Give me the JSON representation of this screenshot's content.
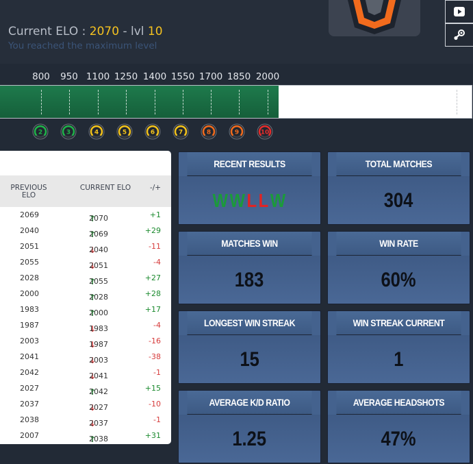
{
  "header": {
    "elo_label": "Current ELO : ",
    "elo_value": "2070",
    "separator": " - lvl ",
    "level": "10",
    "subtitle": "You reached the maximum level"
  },
  "elo_bar": {
    "ticks": [
      "800",
      "950",
      "1100",
      "1250",
      "1400",
      "1550",
      "1700",
      "1850",
      "2000"
    ],
    "fill_fraction": 0.59
  },
  "levels": [
    {
      "label": "2",
      "color": "#1fb34a"
    },
    {
      "label": "3",
      "color": "#1fb34a"
    },
    {
      "label": "4",
      "color": "#f2c21b"
    },
    {
      "label": "5",
      "color": "#f2c21b"
    },
    {
      "label": "6",
      "color": "#f2c21b"
    },
    {
      "label": "7",
      "color": "#f2c21b"
    },
    {
      "label": "8",
      "color": "#f26b1d"
    },
    {
      "label": "9",
      "color": "#f26b1d"
    },
    {
      "label": "10",
      "color": "#e52c2c"
    }
  ],
  "table": {
    "headers": {
      "previous": "PREVIOUS ELO",
      "current": "CURRENT ELO",
      "diff": "-/+"
    },
    "rows": [
      {
        "prev": "2069",
        "cur": "2070",
        "dir": "up",
        "diff": "+1"
      },
      {
        "prev": "2040",
        "cur": "2069",
        "dir": "up",
        "diff": "+29"
      },
      {
        "prev": "2051",
        "cur": "2040",
        "dir": "down",
        "diff": "-11"
      },
      {
        "prev": "2055",
        "cur": "2051",
        "dir": "down",
        "diff": "-4"
      },
      {
        "prev": "2028",
        "cur": "2055",
        "dir": "up",
        "diff": "+27"
      },
      {
        "prev": "2000",
        "cur": "2028",
        "dir": "up",
        "diff": "+28"
      },
      {
        "prev": "1983",
        "cur": "2000",
        "dir": "up",
        "diff": "+17"
      },
      {
        "prev": "1987",
        "cur": "1983",
        "dir": "down",
        "diff": "-4"
      },
      {
        "prev": "2003",
        "cur": "1987",
        "dir": "down",
        "diff": "-16"
      },
      {
        "prev": "2041",
        "cur": "2003",
        "dir": "down",
        "diff": "-38"
      },
      {
        "prev": "2042",
        "cur": "2041",
        "dir": "down",
        "diff": "-1"
      },
      {
        "prev": "2027",
        "cur": "2042",
        "dir": "up",
        "diff": "+15"
      },
      {
        "prev": "2037",
        "cur": "2027",
        "dir": "down",
        "diff": "-10"
      },
      {
        "prev": "2038",
        "cur": "2037",
        "dir": "down",
        "diff": "-1"
      },
      {
        "prev": "2007",
        "cur": "2038",
        "dir": "up",
        "diff": "+31"
      }
    ]
  },
  "stats": {
    "recent_results": {
      "title": "RECENT RESULTS",
      "results": [
        "W",
        "W",
        "L",
        "L",
        "W"
      ]
    },
    "total_matches": {
      "title": "TOTAL MATCHES",
      "value": "304"
    },
    "matches_win": {
      "title": "MATCHES WIN",
      "value": "183"
    },
    "win_rate": {
      "title": "WIN RATE",
      "value": "60%"
    },
    "longest_win_streak": {
      "title": "LONGEST WIN STREAK",
      "value": "15"
    },
    "win_streak_current": {
      "title": "WIN STREAK CURRENT",
      "value": "1"
    },
    "average_kd_ratio": {
      "title": "AVERAGE K/D RATIO",
      "value": "1.25"
    },
    "average_headshots": {
      "title": "AVERAGE HEADSHOTS",
      "value": "47%"
    }
  },
  "colors": {
    "accent": "#f5c220",
    "win": "#1b9a3a",
    "loss": "#e02424",
    "bar": "#1e7a4c",
    "card": "#44628e"
  },
  "icons": {
    "badge": "faceit-level-badge-icon",
    "side_1": "youtube-play-icon",
    "side_2": "steam-icon"
  }
}
